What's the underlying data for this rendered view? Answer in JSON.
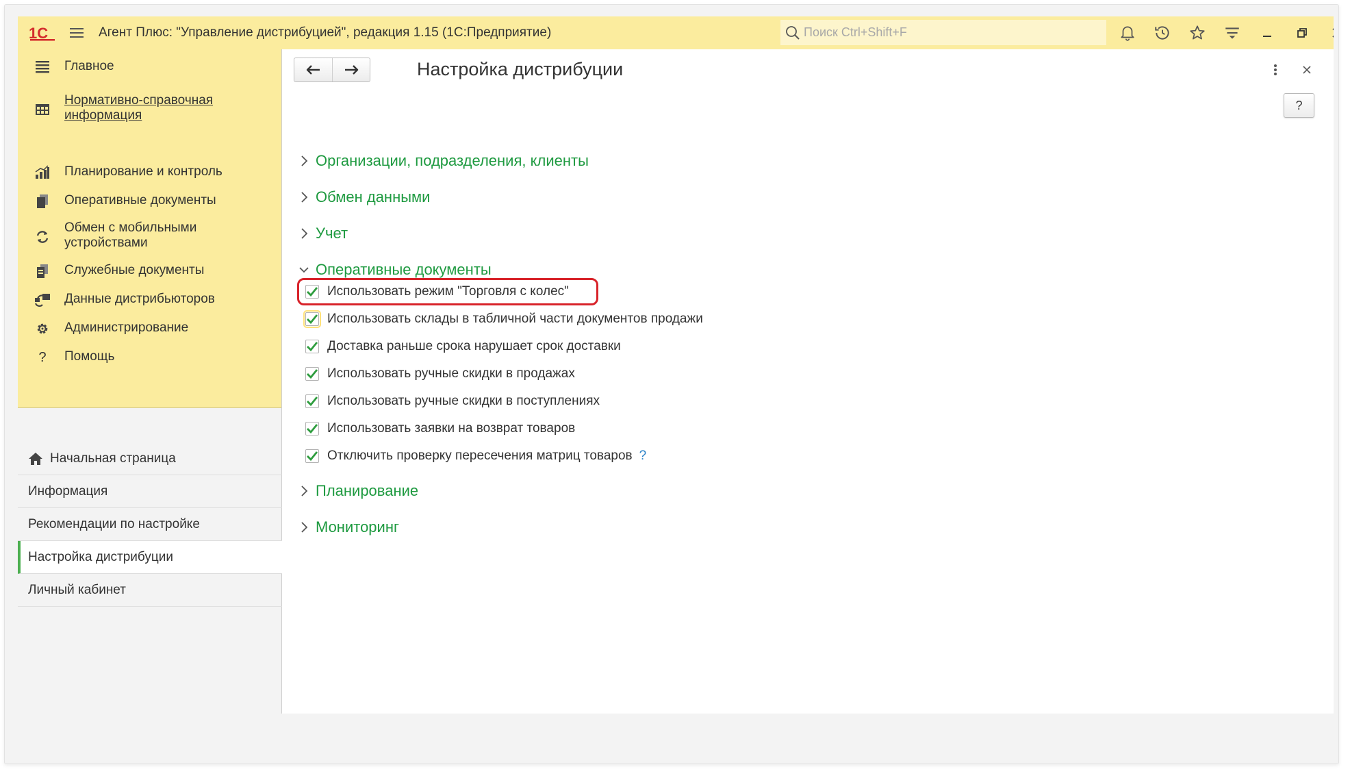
{
  "app": {
    "logo_text": "1С",
    "title": "Агент Плюс: \"Управление дистрибуцией\", редакция 1.15  (1С:Предприятие)",
    "search_placeholder": "Поиск Ctrl+Shift+F"
  },
  "titlebar_icons": [
    "bell-icon",
    "history-icon",
    "star-icon",
    "funnel-icon",
    "minimize-icon",
    "restore-icon",
    "close-icon"
  ],
  "sidebar": {
    "sections": [
      {
        "label": "Главное",
        "icon": "list-icon",
        "link": false
      },
      {
        "label": "Нормативно-справочная информация",
        "icon": "table-icon",
        "link": true
      },
      {
        "label": "Планирование и контроль",
        "icon": "chart-icon",
        "link": false
      },
      {
        "label": "Оперативные документы",
        "icon": "documents-icon",
        "link": false
      },
      {
        "label": "Обмен с мобильными устройствами",
        "icon": "sync-icon",
        "link": false
      },
      {
        "label": "Служебные документы",
        "icon": "service-docs-icon",
        "link": false
      },
      {
        "label": "Данные дистрибьюторов",
        "icon": "distributor-icon",
        "link": false
      },
      {
        "label": "Администрирование",
        "icon": "gear-icon",
        "link": false
      },
      {
        "label": "Помощь",
        "icon": "help-icon",
        "link": false
      }
    ],
    "open_pages": [
      {
        "label": "Начальная страница",
        "icon": "home-icon",
        "active": false
      },
      {
        "label": "Информация",
        "active": false
      },
      {
        "label": "Рекомендации по настройке",
        "active": false
      },
      {
        "label": "Настройка дистрибуции",
        "active": true
      },
      {
        "label": "Личный кабинет",
        "active": false
      }
    ]
  },
  "content": {
    "title": "Настройка дистрибуции",
    "help_label": "?",
    "groups": [
      {
        "title": "Организации, подразделения, клиенты",
        "expanded": false
      },
      {
        "title": "Обмен данными",
        "expanded": false
      },
      {
        "title": "Учет",
        "expanded": false
      },
      {
        "title": "Оперативные документы",
        "expanded": true
      },
      {
        "title": "Планирование",
        "expanded": false
      },
      {
        "title": "Мониторинг",
        "expanded": false
      }
    ],
    "options": [
      {
        "label": "Использовать режим \"Торговля с колес\"",
        "checked": true
      },
      {
        "label": "Использовать склады в табличной части документов продажи",
        "checked": true
      },
      {
        "label": "Доставка раньше срока нарушает срок доставки",
        "checked": true
      },
      {
        "label": "Использовать ручные скидки в продажах",
        "checked": true
      },
      {
        "label": "Использовать ручные скидки в поступлениях",
        "checked": true
      },
      {
        "label": "Использовать заявки на возврат товаров",
        "checked": true
      },
      {
        "label": "Отключить проверку пересечения матриц товаров",
        "checked": true
      }
    ],
    "option_hint": "?"
  },
  "colors": {
    "accent_yellow": "#fbec9e",
    "group_green": "#1e9a40",
    "check_green": "#2e9d3e",
    "highlight_red": "#d8232a",
    "logo_red": "#d42d2d"
  }
}
